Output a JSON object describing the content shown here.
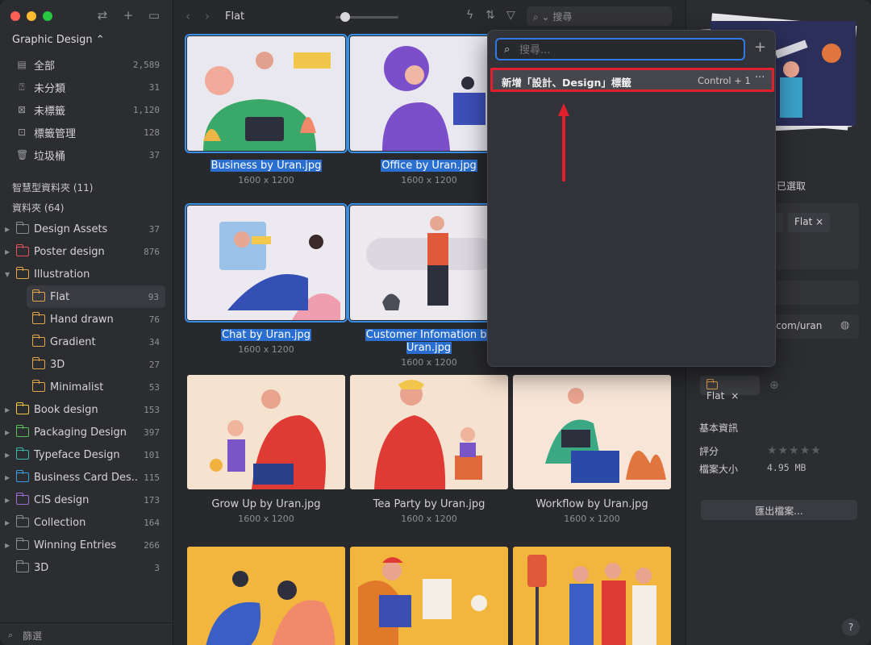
{
  "sidebar": {
    "library": "Graphic Design ⌃",
    "quick": [
      {
        "label": "全部",
        "count": "2,589",
        "icon": "all-items-icon"
      },
      {
        "label": "未分類",
        "count": "31",
        "icon": "uncategorized-icon"
      },
      {
        "label": "未標籤",
        "count": "1,120",
        "icon": "untagged-icon"
      },
      {
        "label": "標籤管理",
        "count": "128",
        "icon": "tag-manager-icon"
      },
      {
        "label": "垃圾桶",
        "count": "37",
        "icon": "trash-icon"
      }
    ],
    "smart_folders": "智慧型資料夾 (11)",
    "folders_title": "資料夾 (64)",
    "folders": [
      {
        "label": "Design Assets",
        "count": "37",
        "color": "#8a8b90"
      },
      {
        "label": "Poster design",
        "count": "876",
        "color": "#e0525a"
      },
      {
        "label": "Illustration",
        "count": "",
        "color": "#e2a54a"
      },
      {
        "label": "Flat",
        "count": "93",
        "color": "#e2a54a"
      },
      {
        "label": "Hand drawn",
        "count": "76",
        "color": "#e2a54a"
      },
      {
        "label": "Gradient",
        "count": "34",
        "color": "#e2a54a"
      },
      {
        "label": "3D",
        "count": "27",
        "color": "#e2a54a"
      },
      {
        "label": "Minimalist",
        "count": "53",
        "color": "#e2a54a"
      },
      {
        "label": "Book design",
        "count": "153",
        "color": "#f0c93f"
      },
      {
        "label": "Packaging Design",
        "count": "397",
        "color": "#5cbf5c"
      },
      {
        "label": "Typeface Design",
        "count": "101",
        "color": "#36b8ab"
      },
      {
        "label": "Business Card Des...",
        "count": "115",
        "color": "#3a9ee0"
      },
      {
        "label": "CIS design",
        "count": "173",
        "color": "#9a6ed6"
      },
      {
        "label": "Collection",
        "count": "164",
        "color": "#8a8b90"
      },
      {
        "label": "Winning Entries",
        "count": "266",
        "color": "#8a8b90"
      },
      {
        "label": "3D",
        "count": "3",
        "color": "#8a8b90"
      }
    ],
    "filter": "篩選"
  },
  "toolbar": {
    "breadcrumb": "Flat",
    "search_placeholder": "搜尋",
    "zoom_percent": 15
  },
  "tiles": [
    {
      "name": "Business by Uran.jpg",
      "dim": "1600 x 1200"
    },
    {
      "name": "Office by Uran.jpg",
      "dim": "1600 x 1200"
    },
    {
      "name": "Chat by Uran.jpg",
      "dim": "1600 x 1200"
    },
    {
      "name": "Customer Infomation by Uran.jpg",
      "dim": "1600 x 1200"
    },
    {
      "name": "Grow Up by Uran.jpg",
      "dim": "1600 x 1200"
    },
    {
      "name": "Tea Party by Uran.jpg",
      "dim": "1600 x 1200"
    },
    {
      "name": "Workflow by Uran.jpg",
      "dim": "1600 x 1200"
    }
  ],
  "popover": {
    "placeholder": "搜尋...",
    "item_label": "新增「設計、Design」標籤",
    "item_shortcut": "Control + 1",
    "item_more": "···"
  },
  "inspector": {
    "selected_text": "案已選取",
    "tag_chip": "Flat ×",
    "url_fragment": "e.com/uran",
    "folder_chip": "Flat",
    "basic_info": "基本資訊",
    "rating_label": "評分",
    "filesize_label": "檔案大小",
    "filesize_value": "4.95 MB",
    "export_button": "匯出檔案..."
  },
  "help": "?"
}
